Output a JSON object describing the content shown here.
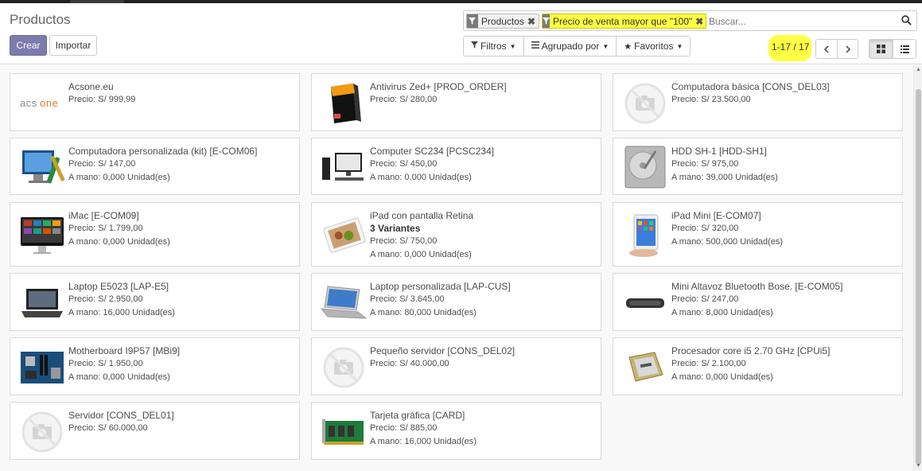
{
  "control_panel": {
    "title": "Productos",
    "create_label": "Crear",
    "import_label": "Importar"
  },
  "search": {
    "facets": [
      {
        "label": "Productos",
        "highlighted": false
      },
      {
        "label": "Precio de venta mayor que \"100\"",
        "highlighted": true
      }
    ],
    "placeholder": "Buscar..."
  },
  "filters": {
    "filters_label": "Filtros",
    "group_by_label": "Agrupado por",
    "favorites_label": "Favoritos"
  },
  "pager": {
    "text": "1-17 / 17"
  },
  "view_switcher": {
    "active": "kanban"
  },
  "highlight_color": "#ffff44",
  "primary_color": "#7c7bad",
  "products": [
    {
      "name": "Acsone.eu",
      "price": "Precio: S/ 999,99",
      "image": "acsone-logo"
    },
    {
      "name": "Antivirus Zed+ [PROD_ORDER]",
      "price": "Precio: S/ 280,00",
      "image": "software-box"
    },
    {
      "name": "Computadora básica [CONS_DEL03]",
      "price": "Precio: S/ 23.500,00",
      "image": "placeholder-camera"
    },
    {
      "name": "Computadora personalizada (kit) [E-COM06]",
      "price": "Precio: S/ 147,00",
      "onhand": "A mano: 0,000 Unidad(es)",
      "image": "computer-kit"
    },
    {
      "name": "Computer SC234 [PCSC234]",
      "price": "Precio: S/ 450,00",
      "onhand": "A mano: 0,000 Unidad(es)",
      "image": "desktop-computer"
    },
    {
      "name": "HDD SH-1 [HDD-SH1]",
      "price": "Precio: S/ 975,00",
      "onhand": "A mano: 39,000 Unidad(es)",
      "image": "hard-drive"
    },
    {
      "name": "iMac [E-COM09]",
      "price": "Precio: S/ 1.799,00",
      "onhand": "A mano: 0,000 Unidad(es)",
      "image": "imac"
    },
    {
      "name": "iPad con pantalla Retina",
      "variants": "3 Variantes",
      "price": "Precio: S/ 750,00",
      "onhand": "A mano: 0,000 Unidad(es)",
      "image": "ipad-retina"
    },
    {
      "name": "iPad Mini [E-COM07]",
      "price": "Precio: S/ 320,00",
      "onhand": "A mano: 500,000 Unidad(es)",
      "image": "ipad-mini"
    },
    {
      "name": "Laptop E5023 [LAP-E5]",
      "price": "Precio: S/ 2.950,00",
      "onhand": "A mano: 16,000 Unidad(es)",
      "image": "laptop-dark"
    },
    {
      "name": "Laptop personalizada [LAP-CUS]",
      "price": "Precio: S/ 3.645,00",
      "onhand": "A mano: 80,000 Unidad(es)",
      "image": "laptop-silver"
    },
    {
      "name": "Mini Altavoz Bluetooth Bose. [E-COM05]",
      "price": "Precio: S/ 247,00",
      "onhand": "A mano: 8,000 Unidad(es)",
      "image": "speaker"
    },
    {
      "name": "Motherboard I9P57 [MBi9]",
      "price": "Precio: S/ 1.950,00",
      "onhand": "A mano: 0,000 Unidad(es)",
      "image": "motherboard"
    },
    {
      "name": "Pequeño servidor [CONS_DEL02]",
      "price": "Precio: S/ 40.000,00",
      "image": "placeholder-camera"
    },
    {
      "name": "Procesador core i5 2.70 GHz [CPUi5]",
      "price": "Precio: S/ 2.100,00",
      "onhand": "A mano: 0,000 Unidad(es)",
      "image": "cpu-chip"
    },
    {
      "name": "Servidor [CONS_DEL01]",
      "price": "Precio: S/ 60.000,00",
      "image": "placeholder-camera"
    },
    {
      "name": "Tarjeta gráfica [CARD]",
      "price": "Precio: S/ 885,00",
      "onhand": "A mano: 16,000 Unidad(es)",
      "image": "graphics-card"
    }
  ]
}
